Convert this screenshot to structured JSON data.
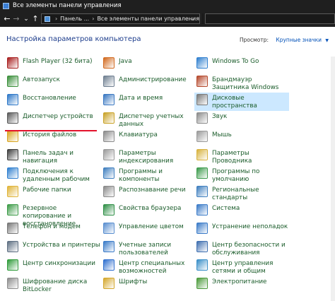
{
  "window": {
    "title": "Все элементы панели управления"
  },
  "address": {
    "crumbs": [
      "Панель ...",
      "Все элементы панели управления"
    ]
  },
  "header": {
    "title": "Настройка параметров компьютера",
    "view_by_label": "Просмотр:",
    "view_by_value": "Крупные значки"
  },
  "icons": {
    "back": "←",
    "forward": "→",
    "recent": "⌄",
    "up": "↑",
    "breadcrumb_sep": "›",
    "dropdown": "⌄",
    "view_caret": "▼"
  },
  "columns": [
    [
      {
        "label": "Flash Player (32 бита)",
        "icon": "flash-icon",
        "color": "#a81e1e"
      },
      {
        "label": "Автозапуск",
        "icon": "autoplay-icon",
        "color": "#3a8f3a"
      },
      {
        "label": "Восстановление",
        "icon": "recovery-icon",
        "color": "#2e78c8"
      },
      {
        "label": "Диспетчер устройств",
        "icon": "device-manager-icon",
        "color": "#5a5a5a"
      },
      {
        "label": "История файлов",
        "icon": "file-history-icon",
        "color": "#d9a521"
      },
      {
        "label": "Панель задач и навигация",
        "icon": "taskbar-icon",
        "color": "#3d3d3d"
      },
      {
        "label": "Подключения к удаленным рабочим",
        "icon": "remote-desktop-icon",
        "color": "#2f7fcf"
      },
      {
        "label": "Рабочие папки",
        "icon": "work-folders-icon",
        "color": "#e0b43a"
      },
      {
        "label": "Резервное копирование и восстановление",
        "icon": "backup-icon",
        "color": "#3c9b47"
      },
      {
        "label": "Телефон и модем",
        "icon": "phone-modem-icon",
        "color": "#777777"
      },
      {
        "label": "Устройства и принтеры",
        "icon": "printers-icon",
        "color": "#5e6f82"
      },
      {
        "label": "Центр синхронизации",
        "icon": "sync-center-icon",
        "color": "#2f9b3a"
      },
      {
        "label": "Шифрование диска BitLocker",
        "icon": "bitlocker-icon",
        "color": "#8c8c8c"
      }
    ],
    [
      {
        "label": "Java",
        "icon": "java-icon",
        "color": "#d2691e"
      },
      {
        "label": "Администрирование",
        "icon": "admin-tools-icon",
        "color": "#6f7f91"
      },
      {
        "label": "Дата и время",
        "icon": "date-time-icon",
        "color": "#3a78c2"
      },
      {
        "label": "Диспетчер учетных данных",
        "icon": "credential-manager-icon",
        "color": "#c9a227"
      },
      {
        "label": "Клавиатура",
        "icon": "keyboard-icon",
        "color": "#8a8a8a"
      },
      {
        "label": "Параметры индексирования",
        "icon": "indexing-icon",
        "color": "#9a9a9a"
      },
      {
        "label": "Программы и компоненты",
        "icon": "programs-icon",
        "color": "#3f7fbf"
      },
      {
        "label": "Распознавание речи",
        "icon": "speech-icon",
        "color": "#8a8a8a"
      },
      {
        "label": "Свойства браузера",
        "icon": "internet-options-icon",
        "color": "#2f8f46"
      },
      {
        "label": "Управление цветом",
        "icon": "color-management-icon",
        "color": "#5a8fd0"
      },
      {
        "label": "Учетные записи пользователей",
        "icon": "user-accounts-icon",
        "color": "#3b7bc8"
      },
      {
        "label": "Центр специальных возможностей",
        "icon": "ease-of-access-icon",
        "color": "#2f6fcf"
      },
      {
        "label": "Шрифты",
        "icon": "fonts-icon",
        "color": "#d4a72c"
      }
    ],
    [
      {
        "label": "Windows To Go",
        "icon": "windows-to-go-icon",
        "color": "#2f7fcf"
      },
      {
        "label": "Брандмауэр Защитника Windows",
        "icon": "firewall-icon",
        "color": "#b5482c"
      },
      {
        "label": "Дисковые пространства",
        "icon": "storage-spaces-icon",
        "color": "#7a7a7a"
      },
      {
        "label": "Звук",
        "icon": "sound-icon",
        "color": "#8c8c8c"
      },
      {
        "label": "Мышь",
        "icon": "mouse-icon",
        "color": "#9a9a9a"
      },
      {
        "label": "Параметры Проводника",
        "icon": "explorer-options-icon",
        "color": "#d8b23d"
      },
      {
        "label": "Программы по умолчанию",
        "icon": "default-programs-icon",
        "color": "#3a9a4a"
      },
      {
        "label": "Региональные стандарты",
        "icon": "region-icon",
        "color": "#3f7fbf"
      },
      {
        "label": "Система",
        "icon": "system-icon",
        "color": "#3b7bc8"
      },
      {
        "label": "Устранение неполадок",
        "icon": "troubleshooting-icon",
        "color": "#3b7bc8"
      },
      {
        "label": "Центр безопасности и обслуживания",
        "icon": "security-maintenance-icon",
        "color": "#3f6fb0"
      },
      {
        "label": "Центр управления сетями и общим",
        "icon": "network-center-icon",
        "color": "#3a8fc8"
      },
      {
        "label": "Электропитание",
        "icon": "power-options-icon",
        "color": "#4a9a3a"
      }
    ]
  ]
}
